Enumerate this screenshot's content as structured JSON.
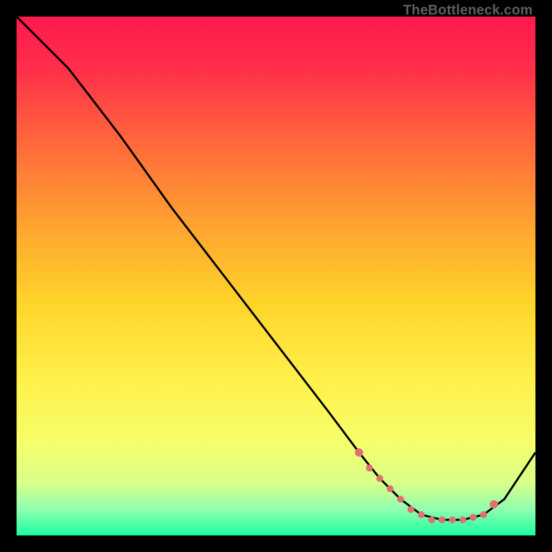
{
  "watermark": "TheBottleneck.com",
  "chart_data": {
    "type": "line",
    "title": "",
    "xlabel": "",
    "ylabel": "",
    "xlim": [
      0,
      100
    ],
    "ylim": [
      0,
      100
    ],
    "grid": false,
    "series": [
      {
        "name": "curve",
        "x": [
          0,
          6,
          10,
          20,
          30,
          40,
          50,
          60,
          66,
          70,
          74,
          78,
          82,
          86,
          90,
          94,
          100
        ],
        "y": [
          100,
          94,
          90,
          77,
          63,
          50,
          37,
          24,
          16,
          11,
          7,
          4,
          3,
          3,
          4,
          7,
          16
        ]
      }
    ],
    "markers": {
      "name": "dots",
      "color": "#e07072",
      "x": [
        66,
        68,
        70,
        72,
        74,
        76,
        78,
        80,
        82,
        84,
        86,
        88,
        90,
        92
      ],
      "y": [
        16,
        13,
        11,
        9,
        7,
        5,
        4,
        3,
        3,
        3,
        3,
        3.5,
        4,
        6
      ]
    },
    "gradient_stops": [
      {
        "offset": 0.0,
        "color": "#ff1a4d"
      },
      {
        "offset": 0.1,
        "color": "#ff2e4a"
      },
      {
        "offset": 0.25,
        "color": "#ff6b3a"
      },
      {
        "offset": 0.4,
        "color": "#ffa230"
      },
      {
        "offset": 0.55,
        "color": "#ffd42a"
      },
      {
        "offset": 0.7,
        "color": "#fff04a"
      },
      {
        "offset": 0.82,
        "color": "#f6ff6a"
      },
      {
        "offset": 0.9,
        "color": "#d8ff8a"
      },
      {
        "offset": 0.95,
        "color": "#8fffb0"
      },
      {
        "offset": 1.0,
        "color": "#1aff9e"
      }
    ]
  }
}
